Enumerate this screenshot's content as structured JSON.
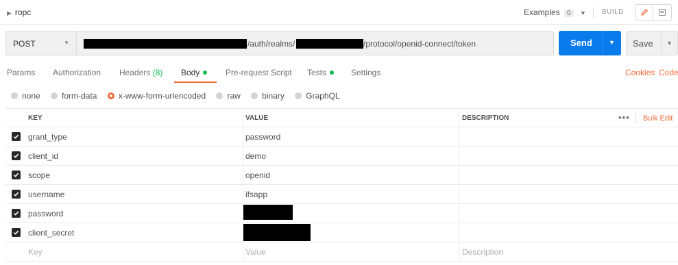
{
  "header": {
    "collection_name": "ropc",
    "examples_label": "Examples",
    "examples_count": "0",
    "build_label": "BUILD"
  },
  "request": {
    "method": "POST",
    "url_segment_1": "/auth/realms/",
    "url_segment_2": "/protocol/openid-connect/token",
    "send_label": "Send",
    "save_label": "Save"
  },
  "tabs": [
    {
      "label": "Params"
    },
    {
      "label": "Authorization"
    },
    {
      "label": "Headers",
      "badge": "(8)"
    },
    {
      "label": "Body"
    },
    {
      "label": "Pre-request Script"
    },
    {
      "label": "Tests"
    },
    {
      "label": "Settings"
    }
  ],
  "links": {
    "cookies": "Cookies",
    "code": "Code"
  },
  "body_types": [
    {
      "label": "none",
      "selected": false
    },
    {
      "label": "form-data",
      "selected": false
    },
    {
      "label": "x-www-form-urlencoded",
      "selected": true
    },
    {
      "label": "raw",
      "selected": false
    },
    {
      "label": "binary",
      "selected": false
    },
    {
      "label": "GraphQL",
      "selected": false
    }
  ],
  "table": {
    "headers": {
      "key": "KEY",
      "value": "VALUE",
      "description": "DESCRIPTION"
    },
    "more": "•••",
    "bulk_edit": "Bulk Edit",
    "rows": [
      {
        "key": "grant_type",
        "value": "password",
        "checked": true
      },
      {
        "key": "client_id",
        "value": "demo",
        "checked": true
      },
      {
        "key": "scope",
        "value": "openid",
        "checked": true
      },
      {
        "key": "username",
        "value": "ifsapp",
        "checked": true
      },
      {
        "key": "password",
        "value": "",
        "checked": true,
        "redacted": true
      },
      {
        "key": "client_secret",
        "value": "",
        "checked": true,
        "redacted": true
      }
    ],
    "placeholders": {
      "key": "Key",
      "value": "Value",
      "description": "Description"
    }
  },
  "colors": {
    "accent": "#f26b3a",
    "send": "#097bed",
    "status_green": "#0cbb52"
  }
}
